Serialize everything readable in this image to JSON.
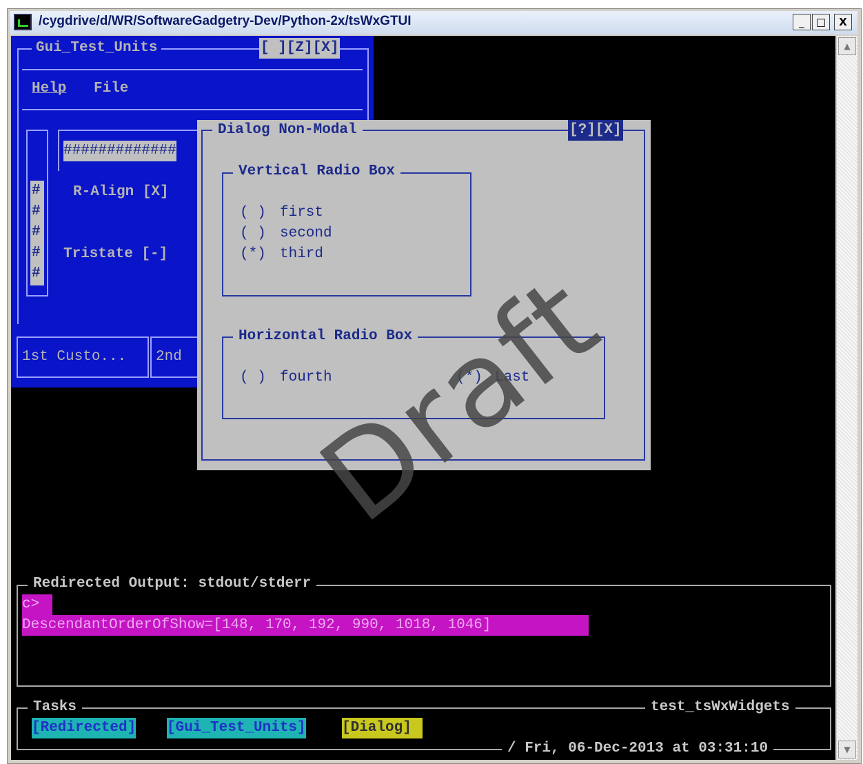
{
  "window": {
    "title": "/cygdrive/d/WR/SoftwareGadgetry-Dev/Python-2x/tsWxGTUI",
    "minimize_label": "_",
    "maximize_label": "□",
    "close_label": "X",
    "scroll_up": "▲",
    "scroll_down": "▼"
  },
  "gui_frame": {
    "title": "Gui_Test_Units",
    "title_buttons": "[ ][Z][X]",
    "menu": [
      {
        "label": "Help"
      },
      {
        "label": "File"
      }
    ],
    "hash_field": "#############",
    "scroll_hashes": [
      "#",
      "#",
      "#",
      "#",
      "#"
    ],
    "r_align": "R-Align [X]",
    "tristate": "Tristate [-]",
    "button1": "1st Custo...",
    "button2": "2nd"
  },
  "dialog": {
    "title": "Dialog Non-Modal",
    "title_buttons": "[?][X]",
    "vertical_box": {
      "title": "Vertical Radio Box",
      "options": [
        {
          "mark": "( )",
          "label": "first"
        },
        {
          "mark": "( )",
          "label": "second"
        },
        {
          "mark": "(*)",
          "label": "third"
        }
      ]
    },
    "horizontal_box": {
      "title": "Horizontal Radio Box",
      "options": [
        {
          "mark": "( )",
          "label": "fourth"
        },
        {
          "mark": "(*)",
          "label": "Last"
        }
      ]
    }
  },
  "output": {
    "title": "Redirected Output: stdout/stderr",
    "lines": [
      "c>",
      "DescendantOrderOfShow=[148, 170, 192, 990, 1018, 1046]"
    ]
  },
  "tasks": {
    "title": "Tasks",
    "app_name": "test_tsWxWidgets",
    "items": [
      {
        "label": "[Redirected]"
      },
      {
        "label": "[Gui_Test_Units]"
      },
      {
        "label": "[Dialog]"
      }
    ],
    "timestamp": "/ Fri, 06-Dec-2013 at 03:31:10"
  },
  "watermark": "Draft",
  "colors": {
    "terminal_bg": "#000000",
    "frame_blue": "#0a14c8",
    "dialog_grey": "#c0c0c0",
    "text_navy": "#1c2a8a",
    "highlight_magenta": "#c414c4",
    "task_cyan": "#1eb4b4",
    "task_yellow": "#c8c81e"
  }
}
